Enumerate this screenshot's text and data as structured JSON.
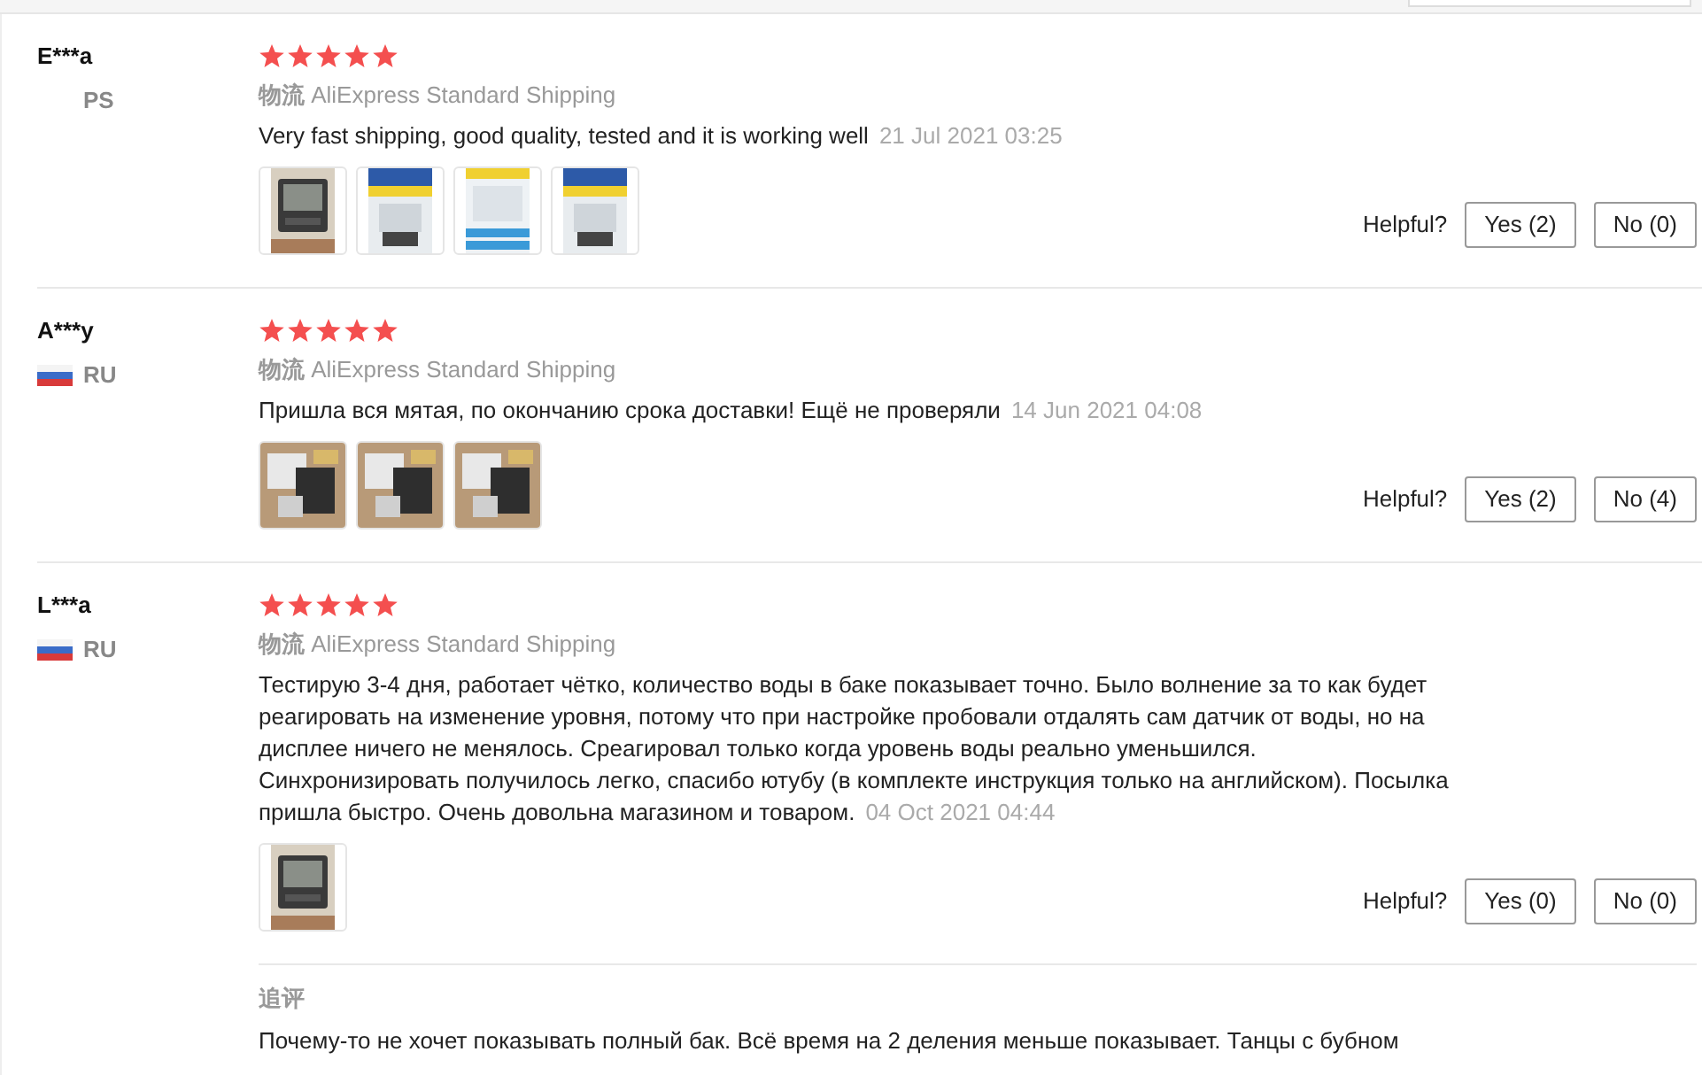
{
  "reviews": [
    {
      "user": "E***a",
      "country": "PS",
      "has_flag": false,
      "stars": 5,
      "shipping_label": "物流",
      "shipping_method": "AliExpress Standard Shipping",
      "text": "Very fast shipping, good quality, tested and it is working well",
      "date": "21 Jul 2021 03:25",
      "photos": [
        {
          "kind": "picture"
        },
        {
          "kind": "picture"
        },
        {
          "kind": "picture"
        },
        {
          "kind": "picture"
        }
      ],
      "helpful_label": "Helpful?",
      "yes": "Yes (2)",
      "no": "No (0)"
    },
    {
      "user": "A***y",
      "country": "RU",
      "has_flag": true,
      "stars": 5,
      "shipping_label": "物流",
      "shipping_method": "AliExpress Standard Shipping",
      "text": "Пришла вся мятая, по окончанию срока доставки! Ещё не проверяли",
      "date": "14 Jun 2021 04:08",
      "photos": [
        {
          "kind": "picture"
        },
        {
          "kind": "picture"
        },
        {
          "kind": "picture"
        }
      ],
      "helpful_label": "Helpful?",
      "yes": "Yes (2)",
      "no": "No (4)"
    },
    {
      "user": "L***a",
      "country": "RU",
      "has_flag": true,
      "stars": 5,
      "shipping_label": "物流",
      "shipping_method": "AliExpress Standard Shipping",
      "text": "Тестирую 3-4 дня, работает чётко, количество воды в баке показывает точно. Было волнение за то как будет реагировать на изменение уровня, потому что при настройке пробовали отдалять сам датчик от воды, но на дисплее ничего не менялось. Среагировал только когда уровень воды реально уменьшился. Синхронизировать получилось легко, спасибо ютубу (в комплекте инструкция только на английском). Посылка пришла быстро. Очень довольна магазином и товаром.",
      "date": "04 Oct 2021 04:44",
      "photos": [
        {
          "kind": "picture"
        }
      ],
      "helpful_label": "Helpful?",
      "yes": "Yes (0)",
      "no": "No (0)",
      "follow_up": {
        "label": "追评",
        "text": "Почему-то не хочет показывать полный бак. Всё время на 2 деления меньше показывает. Танцы с бубном"
      }
    }
  ]
}
